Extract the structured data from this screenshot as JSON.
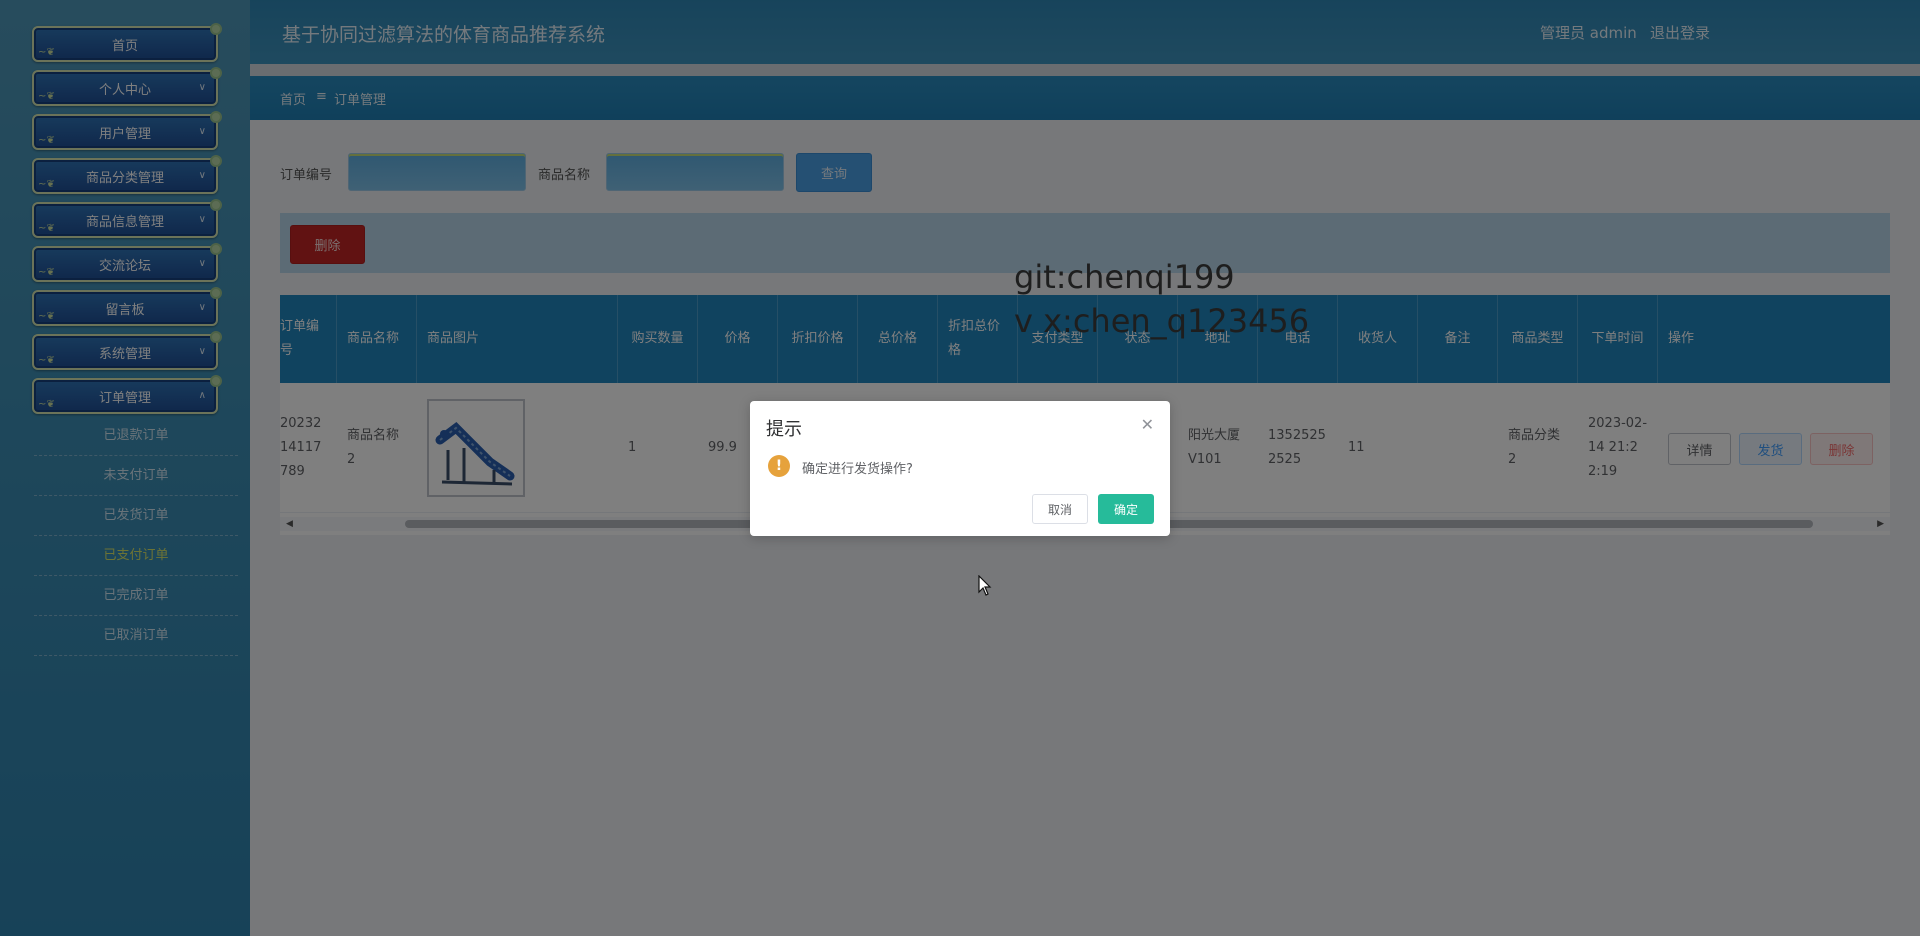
{
  "header": {
    "title": "基于协同过滤算法的体育商品推荐系统",
    "user": "管理员 admin",
    "logout": "退出登录"
  },
  "sidebar": {
    "menus": [
      {
        "label": "首页"
      },
      {
        "label": "个人中心"
      },
      {
        "label": "用户管理"
      },
      {
        "label": "商品分类管理"
      },
      {
        "label": "商品信息管理"
      },
      {
        "label": "交流论坛"
      },
      {
        "label": "留言板"
      },
      {
        "label": "系统管理"
      },
      {
        "label": "订单管理"
      }
    ],
    "submenu": [
      {
        "label": "已退款订单"
      },
      {
        "label": "未支付订单"
      },
      {
        "label": "已发货订单"
      },
      {
        "label": "已支付订单",
        "active": true
      },
      {
        "label": "已完成订单"
      },
      {
        "label": "已取消订单"
      }
    ]
  },
  "breadcrumb": {
    "home": "首页",
    "separator": "≡",
    "current": "订单管理"
  },
  "search": {
    "order_no_label": "订单编号",
    "order_no_value": "",
    "product_name_label": "商品名称",
    "product_name_value": "",
    "query_button": "查询"
  },
  "toolbar": {
    "delete_button": "删除"
  },
  "table": {
    "headers": [
      "订单编号",
      "商品名称",
      "商品图片",
      "购买数量",
      "价格",
      "折扣价格",
      "总价格",
      "折扣总价格",
      "支付类型",
      "状态",
      "地址",
      "电话",
      "收货人",
      "备注",
      "商品类型",
      "下单时间",
      "操作"
    ],
    "rows": [
      {
        "order_no": "2023214117789",
        "product_name": "商品名称2",
        "quantity": "1",
        "price": "99.9",
        "discount_price": "",
        "total": "",
        "discount_total": "",
        "pay_type": "",
        "status": "",
        "address": "阳光大厦V101",
        "phone": "13525252525",
        "receiver": "11",
        "remark": "",
        "category": "商品分类2",
        "order_time": "2023-02-14 21:22:19",
        "actions": {
          "detail": "详情",
          "ship": "发货",
          "delete": "删除"
        }
      }
    ]
  },
  "dialog": {
    "title": "提示",
    "message": "确定进行发货操作?",
    "cancel": "取消",
    "confirm": "确定"
  },
  "watermark": {
    "line1": "git:chenqi199",
    "line2": "v x:chen_q123456"
  },
  "colors": {
    "sidebar_bg": "#3d8fb6",
    "header_bg": "#2f88b7",
    "table_header": "#2187bf",
    "danger": "#c22525",
    "primary": "#4aa0e6",
    "confirm": "#26bb9a",
    "warning": "#e6a23c"
  }
}
